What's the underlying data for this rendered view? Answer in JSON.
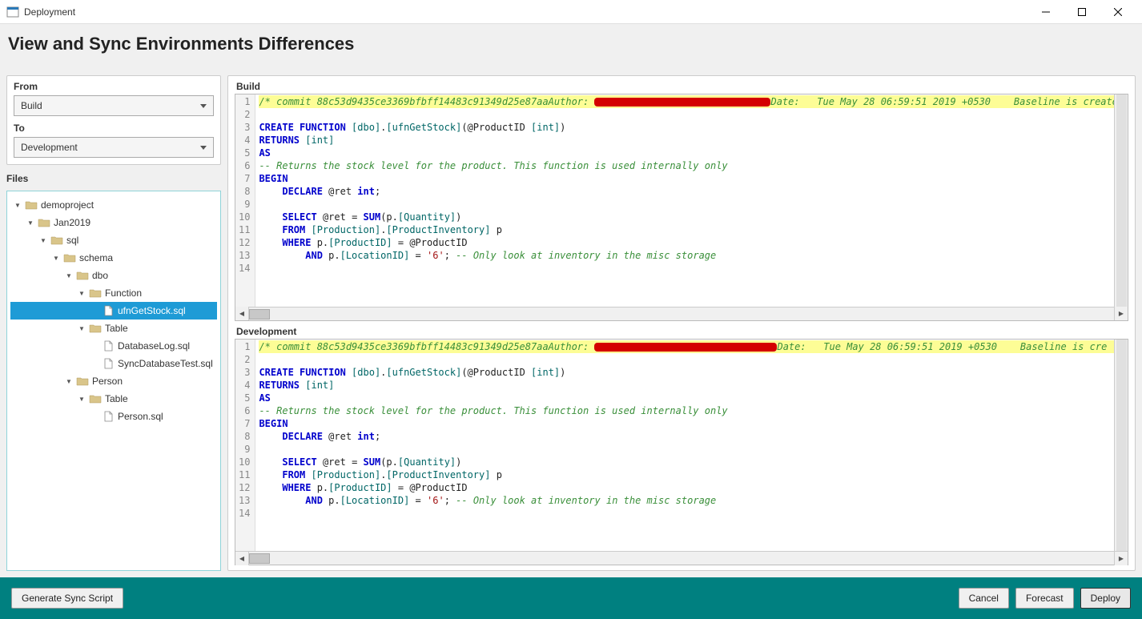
{
  "window": {
    "title": "Deployment"
  },
  "header": {
    "title": "View and Sync Environments Differences"
  },
  "sidebar": {
    "from_label": "From",
    "from_value": "Build",
    "to_label": "To",
    "to_value": "Development",
    "files_label": "Files",
    "tree": [
      {
        "label": "demoproject",
        "type": "folder",
        "indent": 0,
        "expanded": true
      },
      {
        "label": "Jan2019",
        "type": "folder",
        "indent": 1,
        "expanded": true
      },
      {
        "label": "sql",
        "type": "folder",
        "indent": 2,
        "expanded": true
      },
      {
        "label": "schema",
        "type": "folder",
        "indent": 3,
        "expanded": true
      },
      {
        "label": "dbo",
        "type": "folder",
        "indent": 4,
        "expanded": true
      },
      {
        "label": "Function",
        "type": "folder",
        "indent": 5,
        "expanded": true
      },
      {
        "label": "ufnGetStock.sql",
        "type": "file",
        "indent": 6,
        "selected": true
      },
      {
        "label": "Table",
        "type": "folder",
        "indent": 5,
        "expanded": true
      },
      {
        "label": "DatabaseLog.sql",
        "type": "file",
        "indent": 6
      },
      {
        "label": "SyncDatabaseTest.sql",
        "type": "file",
        "indent": 6
      },
      {
        "label": "Person",
        "type": "folder",
        "indent": 4,
        "expanded": true
      },
      {
        "label": "Table",
        "type": "folder",
        "indent": 5,
        "expanded": true
      },
      {
        "label": "Person.sql",
        "type": "file",
        "indent": 6
      }
    ]
  },
  "diff": {
    "top_title": "Build",
    "bottom_title": "Development",
    "commit_prefix": "/* commit 88c53d9435ce3369bfbff14483c91349d25e87aaAuthor: ",
    "commit_date": "Date:   Tue May 28 06:59:51 2019 +0530",
    "commit_tail_top": "Baseline is created",
    "commit_tail_bottom": "Baseline is cre",
    "lines": {
      "l3_a": "CREATE FUNCTION ",
      "l3_b": "[dbo]",
      "l3_c": ".",
      "l3_d": "[ufnGetStock]",
      "l3_e": "(@ProductID ",
      "l3_f": "[int]",
      "l3_g": ")",
      "l4_a": "RETURNS ",
      "l4_b": "[int]",
      "l5": "AS",
      "l6": "-- Returns the stock level for the product. This function is used internally only",
      "l7": "BEGIN",
      "l8_a": "    DECLARE ",
      "l8_b": "@ret ",
      "l8_c": "int",
      "l8_d": ";",
      "l10_a": "    SELECT ",
      "l10_b": "@ret ",
      "l10_c": "= ",
      "l10_d": "SUM",
      "l10_e": "(p.",
      "l10_f": "[Quantity]",
      "l10_g": ")",
      "l11_a": "    FROM ",
      "l11_b": "[Production]",
      "l11_c": ".",
      "l11_d": "[ProductInventory]",
      "l11_e": " p",
      "l12_a": "    WHERE ",
      "l12_b": "p.",
      "l12_c": "[ProductID]",
      "l12_d": " = @ProductID",
      "l13_a": "        AND ",
      "l13_b": "p.",
      "l13_c": "[LocationID]",
      "l13_d": " = ",
      "l13_e": "'6'",
      "l13_f": "; ",
      "l13_g": "-- Only look at inventory in the misc storage"
    },
    "line_numbers": [
      1,
      2,
      3,
      4,
      5,
      6,
      7,
      8,
      9,
      10,
      11,
      12,
      13,
      14
    ]
  },
  "footer": {
    "generate": "Generate Sync Script",
    "cancel": "Cancel",
    "forecast": "Forecast",
    "deploy": "Deploy"
  }
}
